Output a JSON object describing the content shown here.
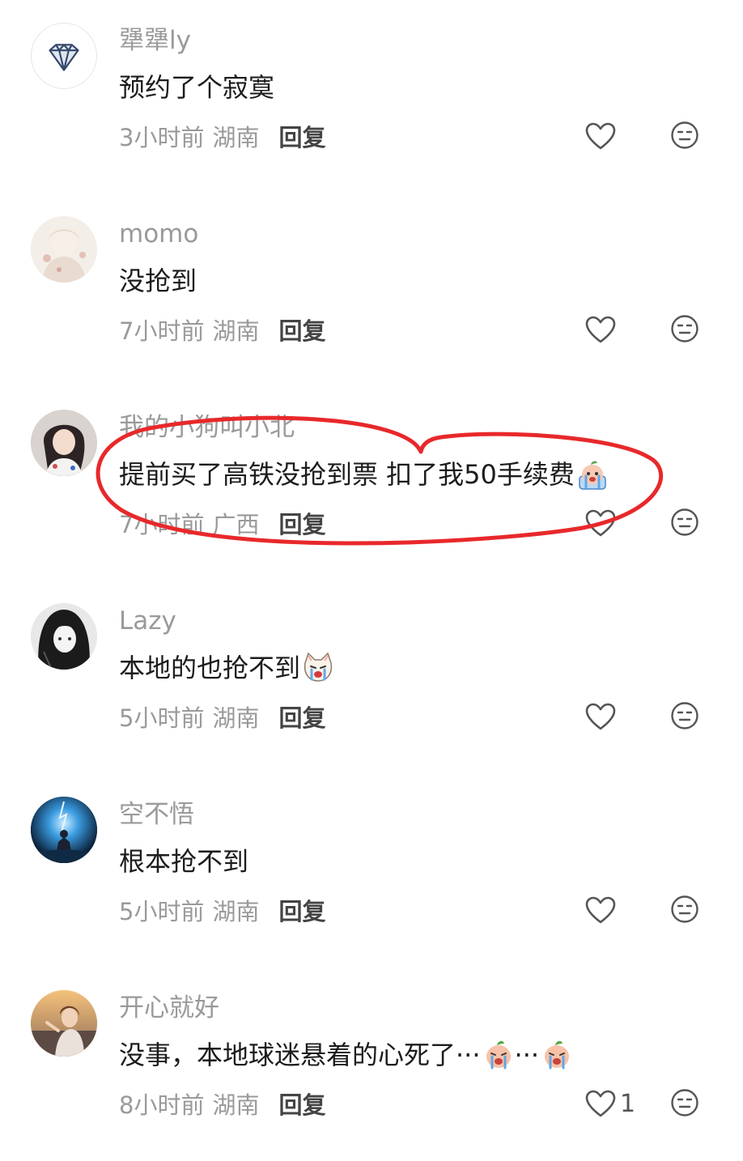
{
  "comments": [
    {
      "username": "犟犟ly",
      "text": "预约了个寂寞",
      "time": "3小时前",
      "location": "湖南",
      "reply": "回复",
      "likes": ""
    },
    {
      "username": "momo",
      "text": "没抢到",
      "time": "7小时前",
      "location": "湖南",
      "reply": "回复",
      "likes": ""
    },
    {
      "username": "我的小狗叫小北",
      "text": "提前买了高铁没抢到票 扣了我50手续费",
      "time": "7小时前",
      "location": "广西",
      "reply": "回复",
      "likes": ""
    },
    {
      "username": "Lazy",
      "text": "本地的也抢不到",
      "time": "5小时前",
      "location": "湖南",
      "reply": "回复",
      "likes": ""
    },
    {
      "username": "空不悟",
      "text": "根本抢不到",
      "time": "5小时前",
      "location": "湖南",
      "reply": "回复",
      "likes": ""
    },
    {
      "username": "开心就好",
      "text": "没事，本地球迷悬着的心死了···",
      "text_tail": "···",
      "time": "8小时前",
      "location": "湖南",
      "reply": "回复",
      "likes": "1"
    }
  ],
  "icons": {
    "like": "heart-icon",
    "dislike": "neutral-face-icon",
    "emoji_cry": "crying-emoji-icon",
    "emoji_cat": "crying-cat-emoji-icon"
  },
  "colors": {
    "annotation": "#e8282b",
    "secondary_text": "#9a9a9a"
  }
}
